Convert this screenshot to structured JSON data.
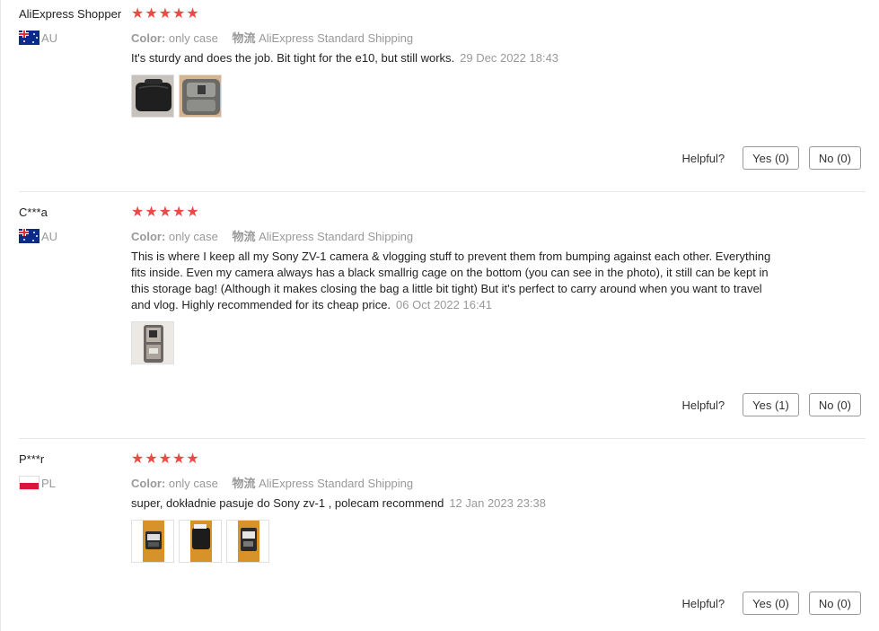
{
  "reviews": [
    {
      "author": "AliExpress Shopper",
      "country": "AU",
      "flag_icon": "australia-flag-icon",
      "stars": 5,
      "color_label": "Color:",
      "color_value": "only case",
      "shipping_label": "物流",
      "shipping_value": "AliExpress Standard Shipping",
      "text": "It's sturdy and does the job. Bit tight for the e10, but still works.",
      "date": "29 Dec 2022 18:43",
      "photos": [
        "photo-black-case-exterior",
        "photo-gray-case-interior"
      ],
      "helpful_label": "Helpful?",
      "yes_label": "Yes (0)",
      "no_label": "No (0)"
    },
    {
      "author": "C***a",
      "country": "AU",
      "flag_icon": "australia-flag-icon",
      "stars": 5,
      "color_label": "Color:",
      "color_value": "only case",
      "shipping_label": "物流",
      "shipping_value": "AliExpress Standard Shipping",
      "text": "This is where I keep all my Sony ZV-1 camera & vlogging stuff to prevent them from bumping against each other. Everything fits inside. Even my camera always has a black smallrig cage on the bottom (you can see in the photo), it still can be kept in this storage bag! (Although it makes closing the bag a little bit tight) But it's perfect to carry around when you want to travel and vlog. Highly recommended for its cheap price.",
      "date": "06 Oct 2022 16:41",
      "photos": [
        "photo-case-with-camera-inside"
      ],
      "helpful_label": "Helpful?",
      "yes_label": "Yes (1)",
      "no_label": "No (0)"
    },
    {
      "author": "P***r",
      "country": "PL",
      "flag_icon": "poland-flag-icon",
      "stars": 5,
      "color_label": "Color:",
      "color_value": "only case",
      "shipping_label": "物流",
      "shipping_value": "AliExpress Standard Shipping",
      "text": "super, dokładnie pasuje do Sony zv-1 , polecam recommend",
      "date": "12 Jan 2023 23:38",
      "photos": [
        "photo-case-open-on-floor",
        "photo-case-closed-on-floor",
        "photo-case-with-camera-on-floor"
      ],
      "helpful_label": "Helpful?",
      "yes_label": "Yes (0)",
      "no_label": "No (0)"
    }
  ],
  "colors": {
    "star": "#f04747",
    "muted": "#999999",
    "separator": "#e8e8e8"
  }
}
